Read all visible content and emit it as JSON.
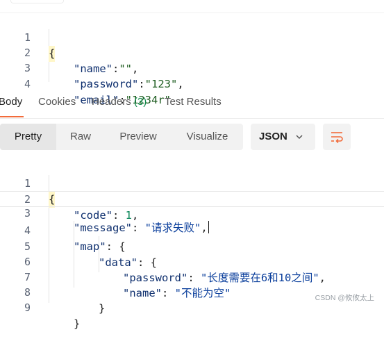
{
  "request_body": {
    "lines": [
      {
        "no": "1",
        "text": "{"
      },
      {
        "no": "2",
        "key": "\"name\"",
        "sep": ":",
        "val": "\"\"",
        "tail": ","
      },
      {
        "no": "3",
        "key": "\"password\"",
        "sep": ":",
        "val": "\"123\"",
        "tail": ","
      },
      {
        "no": "4",
        "key": "\"email\"",
        "sep": ":",
        "val": "\"1234r\"",
        "tail": ""
      }
    ]
  },
  "tabs": [
    {
      "label": "Body",
      "active": true
    },
    {
      "label": "Cookies"
    },
    {
      "label": "Headers",
      "count": "(3)"
    },
    {
      "label": "Test Results"
    }
  ],
  "format_toolbar": {
    "modes": [
      "Pretty",
      "Raw",
      "Preview",
      "Visualize"
    ],
    "active_mode": "Pretty",
    "language": "JSON",
    "wrap_icon": "wrap-lines-icon"
  },
  "response_body": {
    "line_numbers": [
      "1",
      "2",
      "3",
      "4",
      "5",
      "6",
      "7",
      "8",
      "9"
    ],
    "open_brace": "{",
    "code_key": "\"code\"",
    "code_sep": ": ",
    "code_val": "1",
    "code_tail": ",",
    "message_key": "\"message\"",
    "message_sep": ": ",
    "message_val": "\"请求失败\"",
    "message_tail": ",",
    "map_key": "\"map\"",
    "map_sep": ": ",
    "map_open": "{",
    "data_key": "\"data\"",
    "data_sep": ": ",
    "data_open": "{",
    "password_key": "\"password\"",
    "password_sep": ": ",
    "password_val": "\"长度需要在6和10之间\"",
    "password_tail": ",",
    "name_key": "\"name\"",
    "name_sep": ": ",
    "name_val": "\"不能为空\"",
    "close_data": "}",
    "close_map": "}"
  },
  "watermark": "CSDN @攸攸太上",
  "colors": {
    "accent": "#f26b3a",
    "count": "#0f8a4a",
    "number": "#098658"
  }
}
